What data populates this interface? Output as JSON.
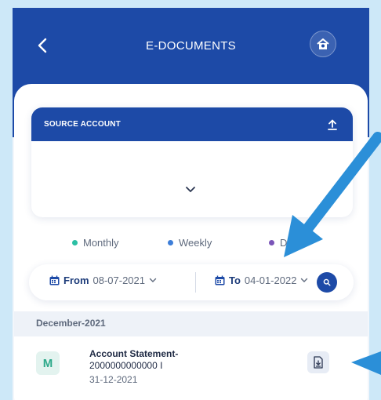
{
  "header": {
    "title": "E-DOCUMENTS",
    "back_icon": "chevron-left-icon",
    "home_icon": "home-icon"
  },
  "source_account": {
    "label": "SOURCE ACCOUNT",
    "upload_icon": "upload-icon",
    "expand_icon": "chevron-down-icon"
  },
  "periods": [
    {
      "label": "Monthly",
      "color": "#2bbfa4"
    },
    {
      "label": "Weekly",
      "color": "#3d7ed8"
    },
    {
      "label": "D",
      "color": "#7a55b8"
    }
  ],
  "date_filter": {
    "from_label": "From",
    "from_value": "08-07-2021",
    "to_label": "To",
    "to_value": "04-01-2022",
    "search_icon": "search-icon"
  },
  "documents": {
    "month": "December-2021",
    "items": [
      {
        "avatar": "M",
        "title": "Account Statement-",
        "number": "2000000000000 I",
        "date": "31-12-2021",
        "action_icon": "download-icon"
      }
    ]
  },
  "colors": {
    "header": "#1d4aa7",
    "background": "#cde8f8",
    "annotation_arrow": "#2b8fd8"
  }
}
